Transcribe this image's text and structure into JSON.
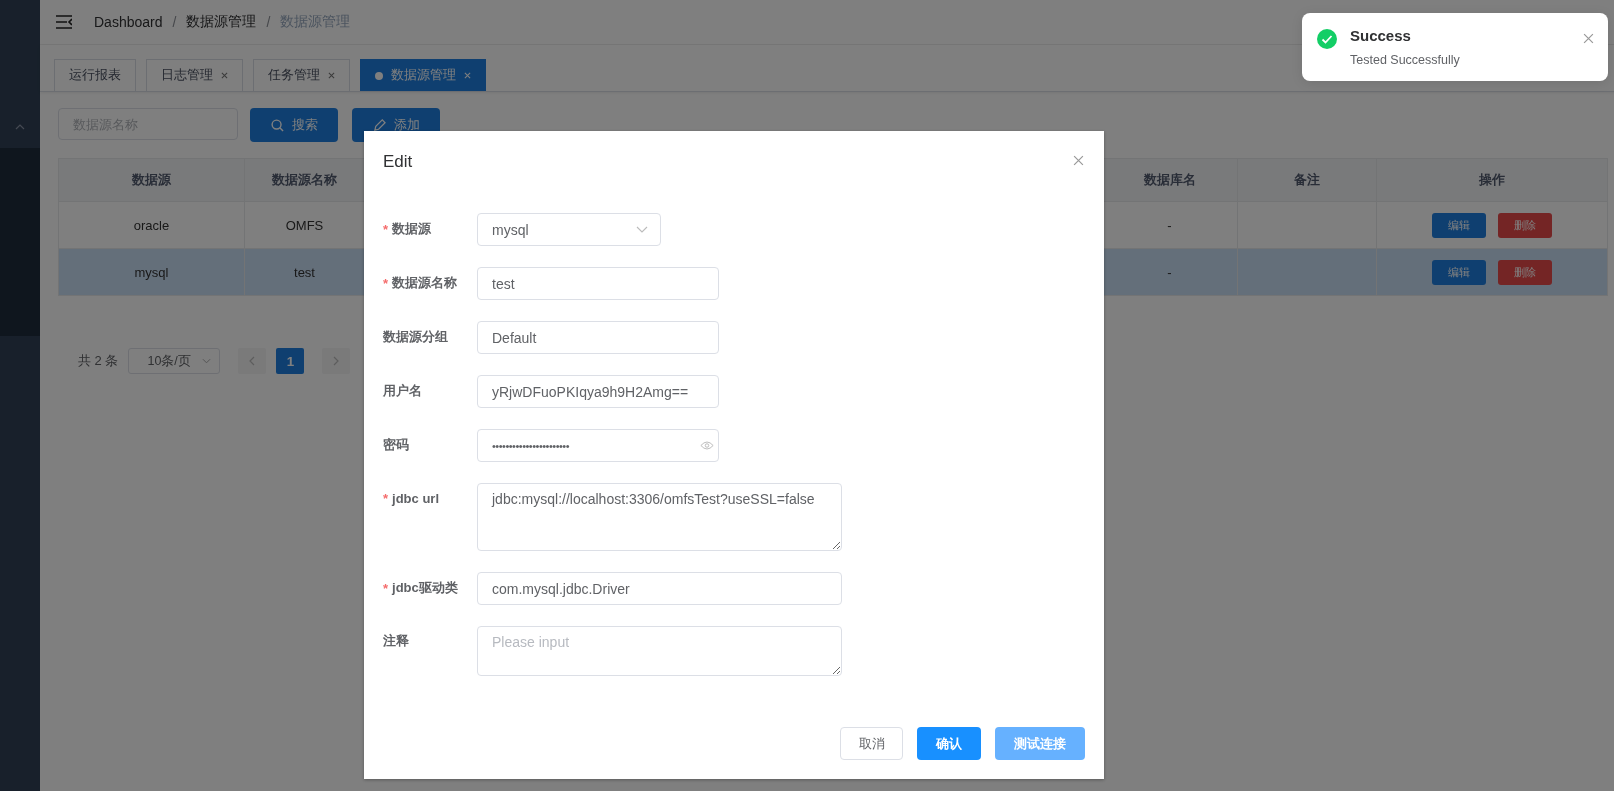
{
  "breadcrumb": [
    {
      "label": "Dashboard",
      "current": false
    },
    {
      "separator": "/",
      "label": "数据源管理",
      "current": false
    },
    {
      "separator": "/",
      "label": "数据源管理",
      "current": true
    }
  ],
  "tabs": [
    {
      "label": "运行报表",
      "selected": false,
      "closable": false
    },
    {
      "label": "日志管理",
      "selected": false,
      "closable": true
    },
    {
      "label": "任务管理",
      "selected": false,
      "closable": true
    },
    {
      "label": "数据源管理",
      "selected": true,
      "closable": true
    }
  ],
  "search": {
    "placeholder": "数据源名称",
    "button": "搜索"
  },
  "add_button": "添加",
  "table": {
    "columns": [
      "数据源",
      "数据源名称",
      "数据库名",
      "备注",
      "操作"
    ],
    "rows": [
      {
        "datasource": "oracle",
        "name": "OMFS",
        "database": "-",
        "actions": [
          "编辑",
          "删除"
        ],
        "selected": false
      },
      {
        "datasource": "mysql",
        "name": "test",
        "database": "-",
        "actions": [
          "编辑",
          "删除"
        ],
        "selected": true
      }
    ]
  },
  "pagination": {
    "total": "共 2 条",
    "page_size": "10条/页",
    "pages": [
      {
        "label": "1",
        "selected": true
      }
    ]
  },
  "dialog": {
    "title": "Edit",
    "fields": [
      {
        "required_mark": "*",
        "label": "数据源",
        "kind": "select",
        "value": "mysql"
      },
      {
        "required_mark": "*",
        "label": "数据源名称",
        "kind": "input",
        "value": "test"
      },
      {
        "label": "数据源分组",
        "kind": "input",
        "value": "Default"
      },
      {
        "label": "用户名",
        "kind": "input",
        "value": "yRjwDFuoPKIqya9h9H2Amg=="
      },
      {
        "label": "密码",
        "kind": "password",
        "value": "•••••••••••••••••••••••"
      },
      {
        "required_mark": "*",
        "label": "jdbc url",
        "kind": "textarea",
        "value": "jdbc:mysql://localhost:3306/omfsTest?useSSL=false"
      },
      {
        "required_mark": "*",
        "label": "jdbc驱动类",
        "kind": "input",
        "value": "com.mysql.jdbc.Driver"
      },
      {
        "label": "注释",
        "kind": "textarea",
        "placeholder": "Please input"
      }
    ],
    "buttons": [
      {
        "label": "取消",
        "kind": "default"
      },
      {
        "label": "确认",
        "kind": "primary"
      },
      {
        "label": "测试连接",
        "kind": "light"
      }
    ]
  },
  "toast": {
    "title": "Success",
    "message": "Tested Successfully"
  }
}
